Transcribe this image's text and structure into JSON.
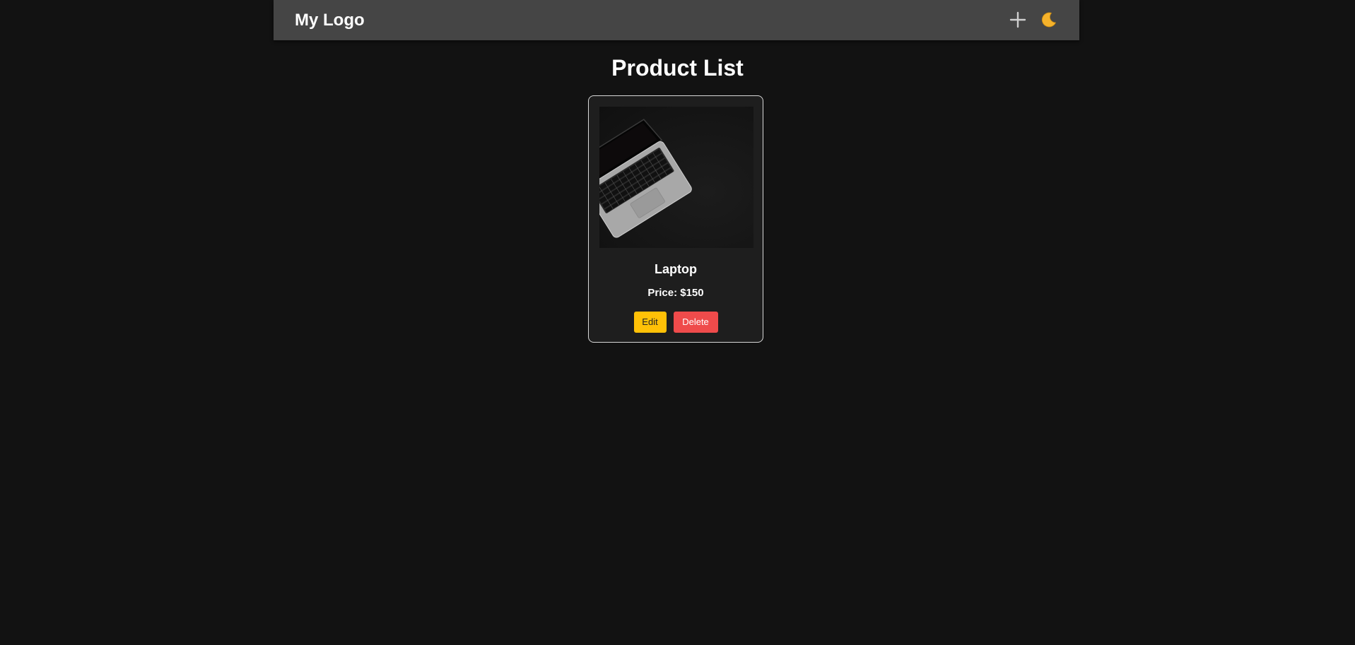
{
  "header": {
    "logo": "My Logo",
    "add_icon": "plus-icon",
    "theme_icon": "crescent-moon-icon"
  },
  "main": {
    "title": "Product List"
  },
  "products": [
    {
      "image_icon": "laptop-image",
      "name": "Laptop",
      "price_text": "Price: $150",
      "edit_label": "Edit",
      "delete_label": "Delete"
    }
  ],
  "colors": {
    "background": "#121212",
    "navbar": "#454545",
    "card": "#1e1e1e",
    "edit_button": "#ffc107",
    "delete_button": "#ef4b4b",
    "moon": "#f5b22b"
  }
}
